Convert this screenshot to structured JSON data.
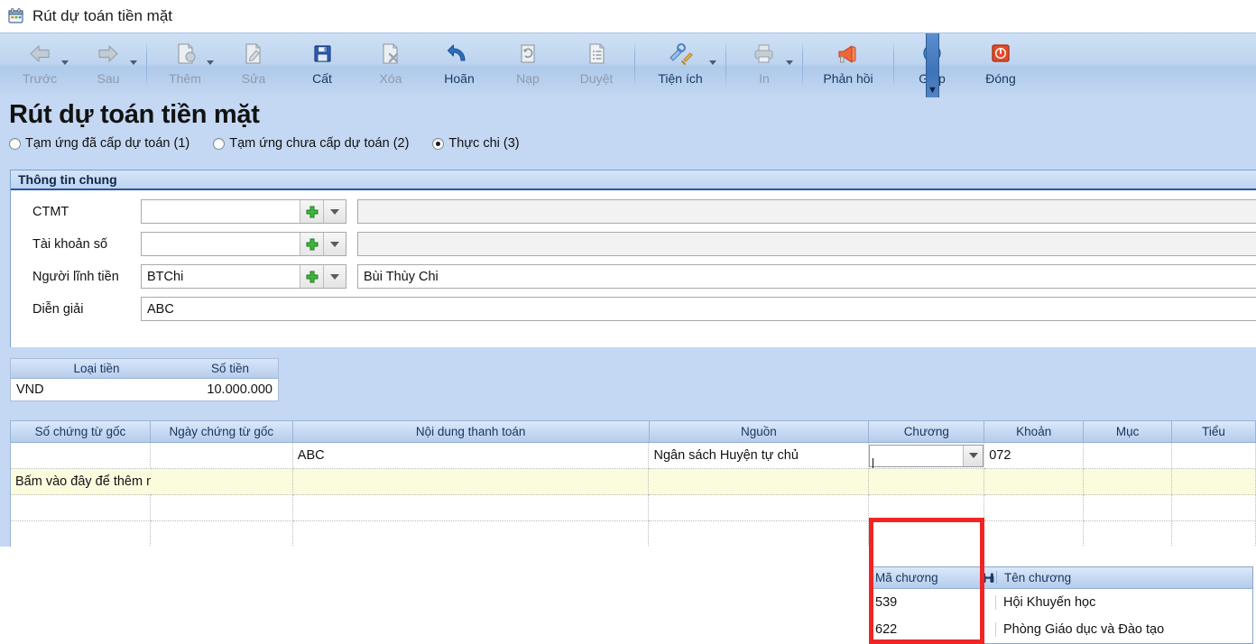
{
  "window": {
    "title": "Rút dự toán tiền mặt",
    "icon": "calendar-icon"
  },
  "toolbar": {
    "items": [
      {
        "label": "Trước",
        "icon": "arrow-left-icon",
        "disabled": true,
        "caret": true
      },
      {
        "label": "Sau",
        "icon": "arrow-right-icon",
        "disabled": true,
        "caret": true
      },
      {
        "label": "Thêm",
        "icon": "add-document-icon",
        "disabled": true,
        "caret": true
      },
      {
        "label": "Sửa",
        "icon": "edit-document-icon",
        "disabled": true,
        "caret": false
      },
      {
        "label": "Cất",
        "icon": "save-floppy-icon",
        "disabled": false,
        "caret": false
      },
      {
        "label": "Xóa",
        "icon": "delete-document-icon",
        "disabled": true,
        "caret": false
      },
      {
        "label": "Hoãn",
        "icon": "undo-arrow-icon",
        "disabled": false,
        "caret": false
      },
      {
        "label": "Nạp",
        "icon": "refresh-page-icon",
        "disabled": true,
        "caret": false
      },
      {
        "label": "Duyệt",
        "icon": "approve-list-icon",
        "disabled": true,
        "caret": false
      },
      {
        "label": "Tiện ích",
        "icon": "tools-icon",
        "disabled": false,
        "caret": true
      },
      {
        "label": "In",
        "icon": "printer-icon",
        "disabled": true,
        "caret": true
      },
      {
        "label": "Phản hồi",
        "icon": "megaphone-icon",
        "disabled": false,
        "caret": false
      },
      {
        "label": "Giúp",
        "icon": "help-circle-icon",
        "disabled": false,
        "caret": false
      },
      {
        "label": "Đóng",
        "icon": "power-close-icon",
        "disabled": false,
        "caret": false
      }
    ],
    "overflow_icon": "ribbon-overflow-icon"
  },
  "page": {
    "title": "Rút dự toán tiền mặt",
    "radios": [
      {
        "label": "Tạm ứng đã cấp dự toán (1)",
        "selected": false
      },
      {
        "label": "Tạm ứng chưa cấp dự toán (2)",
        "selected": false
      },
      {
        "label": "Thực chi (3)",
        "selected": true
      }
    ]
  },
  "general_info": {
    "heading": "Thông tin chung",
    "fields": [
      {
        "label": "CTMT",
        "value": "",
        "name_value": "",
        "readonly_name": true,
        "has_plus": true,
        "has_drop": true
      },
      {
        "label": "Tài khoản số",
        "value": "",
        "name_value": "",
        "readonly_name": true,
        "has_plus": true,
        "has_drop": true
      },
      {
        "label": "Người lĩnh tiền",
        "value": "BTChi",
        "name_value": "Bùi Thùy Chi",
        "readonly_name": false,
        "has_plus": true,
        "has_drop": true
      }
    ],
    "description": {
      "label": "Diễn giải",
      "value": "ABC"
    }
  },
  "currency_grid": {
    "headers": [
      "Loại tiền",
      "Số tiền"
    ],
    "rows": [
      {
        "loai_tien": "VND",
        "so_tien": "10.000.000"
      }
    ]
  },
  "main_grid": {
    "headers": [
      "Số chứng từ gốc",
      "Ngày chứng từ gốc",
      "Nội dung thanh toán",
      "Nguồn",
      "Chương",
      "Khoản",
      "Mục",
      "Tiểu"
    ],
    "rows": [
      {
        "so_chung_tu": "",
        "ngay_chung_tu": "",
        "noi_dung": "ABC",
        "nguon": "Ngân sách Huyện tự chủ",
        "chuong": "",
        "khoan": "072",
        "muc": "",
        "tieu": ""
      }
    ],
    "add_new_label": "Bấm vào đây để thêm mới"
  },
  "chuong_dropdown": {
    "headers": [
      "Mã chương",
      "Tên chương"
    ],
    "search_icon": "binoculars-icon",
    "options": [
      {
        "ma_chuong": "539",
        "ten_chuong": "Hội Khuyến học"
      },
      {
        "ma_chuong": "622",
        "ten_chuong": "Phòng Giáo dục và Đào tạo"
      }
    ]
  },
  "annotation": {
    "highlight_color": "#ef2525"
  },
  "colors": {
    "page_background": "#c4d8f3",
    "ribbon_top": "#cfe0f4",
    "panel_header_border": "#2a56a8",
    "grid_header": "#b4ccec",
    "new_row_background": "#fbfbdd",
    "accent_green": "#3db83d",
    "save_blue": "#2c5fb8"
  }
}
